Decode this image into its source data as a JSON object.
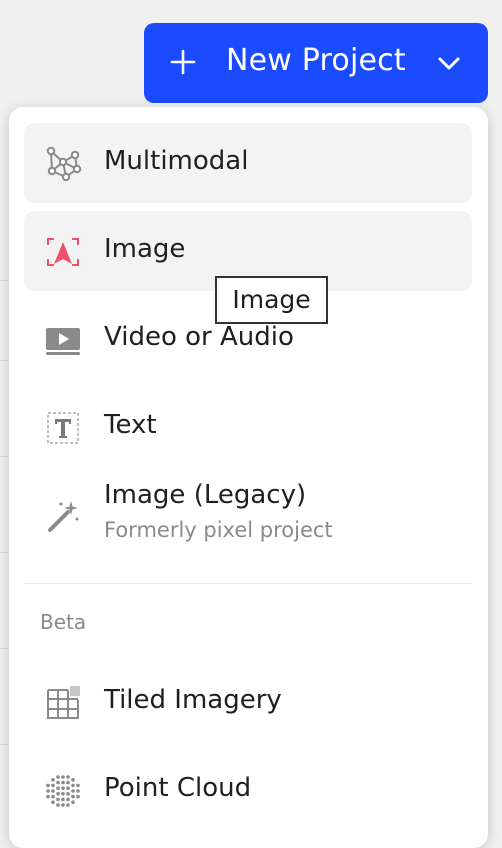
{
  "new_project_button": {
    "label": "New Project",
    "color": "#1a4bff"
  },
  "menu": {
    "items": [
      {
        "label": "Multimodal",
        "icon": "network-nodes-icon"
      },
      {
        "label": "Image",
        "icon": "image-annotation-icon"
      },
      {
        "label": "Video or Audio",
        "icon": "video-play-icon"
      },
      {
        "label": "Text",
        "icon": "text-t-icon"
      },
      {
        "label": "Image (Legacy)",
        "sublabel": "Formerly pixel project",
        "icon": "magic-wand-icon"
      }
    ],
    "beta_section": {
      "label": "Beta",
      "items": [
        {
          "label": "Tiled Imagery",
          "icon": "grid-tiles-icon"
        },
        {
          "label": "Point Cloud",
          "icon": "point-cloud-icon"
        }
      ]
    }
  },
  "tooltip": {
    "text": "Image"
  }
}
